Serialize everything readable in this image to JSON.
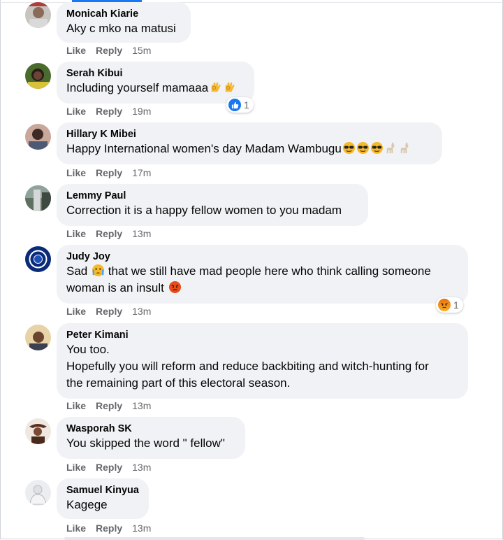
{
  "actions": {
    "like": "Like",
    "reply": "Reply"
  },
  "comments": [
    {
      "author": "Monicah Kiarie",
      "lines": [
        "Aky c mko na matusi"
      ],
      "time": "15m"
    },
    {
      "author": "Serah Kibui",
      "lines": [
        "Including yourself mamaaa"
      ],
      "emojis": [
        "ok-hand-icon",
        "ok-hand-icon"
      ],
      "time": "19m",
      "reaction": {
        "type": "like",
        "count": "1"
      }
    },
    {
      "author": "Hillary K Mibei",
      "lines": [
        "Happy International women's day Madam Wambugu"
      ],
      "emojis": [
        "sunglasses-face-icon",
        "sunglasses-face-icon",
        "sunglasses-face-icon",
        "llama-icon",
        "llama-icon"
      ],
      "time": "17m"
    },
    {
      "author": "Lemmy Paul",
      "lines": [
        "Correction it is a happy fellow women to you madam"
      ],
      "time": "13m"
    },
    {
      "author": "Judy Joy",
      "line1_pre": "Sad",
      "line1_post": "that we still have mad people here who think calling someone",
      "line2": "woman is an insult",
      "emojis": [
        "crying-face-icon",
        "angry-face-icon"
      ],
      "time": "13m",
      "reaction": {
        "type": "angry",
        "count": "1"
      }
    },
    {
      "author": "Peter Kimani",
      "lines": [
        "You too.",
        "Hopefully you will reform and reduce backbiting and witch-hunting for",
        "the remaining part of this electoral season."
      ],
      "time": "13m"
    },
    {
      "author": "Wasporah SK",
      "lines": [
        "You skipped the word \" fellow\""
      ],
      "time": "13m"
    },
    {
      "author": "Samuel Kinyua",
      "lines": [
        "Kagege"
      ],
      "time": "13m"
    }
  ]
}
